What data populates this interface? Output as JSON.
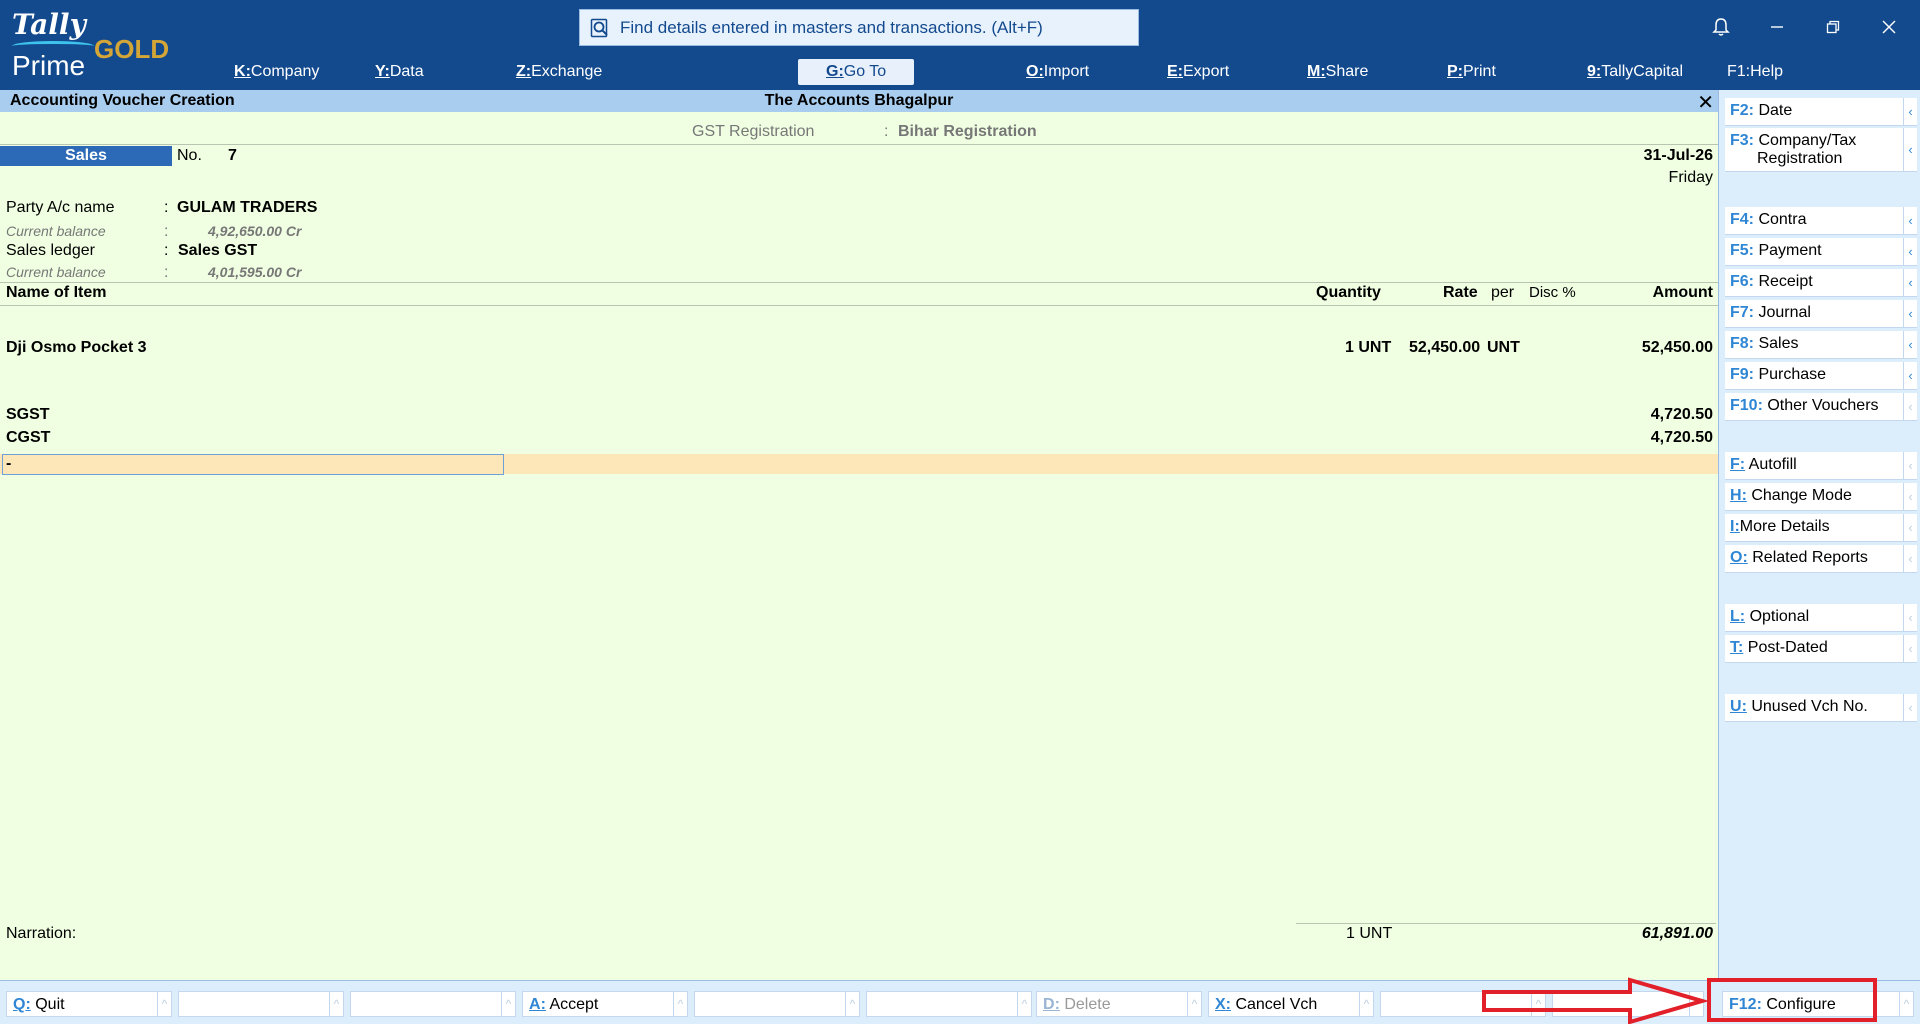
{
  "app": {
    "logo_line1": "Tally",
    "logo_line2": "Prime",
    "logo_edition": "GOLD"
  },
  "search": {
    "text": "Find details entered in masters and transactions. (Alt+F)"
  },
  "menu": [
    {
      "key": "K",
      "label": "Company"
    },
    {
      "key": "Y",
      "label": "Data"
    },
    {
      "key": "Z",
      "label": "Exchange"
    },
    {
      "key": "G",
      "label": "Go To"
    },
    {
      "key": "O",
      "label": "Import"
    },
    {
      "key": "E",
      "label": "Export"
    },
    {
      "key": "M",
      "label": "Share"
    },
    {
      "key": "P",
      "label": "Print"
    },
    {
      "key": "9",
      "label": "TallyCapital"
    },
    {
      "key": "F1",
      "label": "Help"
    }
  ],
  "titlebar": {
    "screen": "Accounting Voucher Creation",
    "company": "The Accounts Bhagalpur",
    "close": "✕"
  },
  "voucher": {
    "gst_label": "GST Registration",
    "gst_sep": ":",
    "gst_value": "Bihar Registration",
    "type": "Sales",
    "no_label": "No.",
    "no_value": "7",
    "date": "31-Jul-26",
    "day": "Friday",
    "party_label": "Party A/c name",
    "party_value": "GULAM TRADERS",
    "party_bal_label": "Current balance",
    "party_bal_value": "4,92,650.00 Cr",
    "sales_label": "Sales ledger",
    "sales_value": "Sales GST",
    "sales_bal_label": "Current balance",
    "sales_bal_value": "4,01,595.00 Cr",
    "sep": ":",
    "columns": {
      "item": "Name of Item",
      "qty": "Quantity",
      "rate": "Rate",
      "per": "per",
      "disc": "Disc %",
      "amount": "Amount"
    },
    "item": {
      "name": "Dji Osmo Pocket 3",
      "qty": "1 UNT",
      "rate": "52,450.00",
      "per": "UNT",
      "amount": "52,450.00"
    },
    "taxes": [
      {
        "name": "SGST",
        "amount": "4,720.50"
      },
      {
        "name": "CGST",
        "amount": "4,720.50"
      }
    ],
    "cursor_text": "-",
    "narration_label": "Narration:",
    "total_qty": "1 UNT",
    "total_amount": "61,891.00"
  },
  "right_panel": [
    {
      "key": "F2",
      "label": "Date",
      "active": true
    },
    {
      "key": "F3",
      "label": "Company/Tax",
      "label2": "Registration",
      "active": true
    },
    {
      "key": "F4",
      "label": "Contra",
      "active": true
    },
    {
      "key": "F5",
      "label": "Payment",
      "active": true
    },
    {
      "key": "F6",
      "label": "Receipt",
      "active": true
    },
    {
      "key": "F7",
      "label": "Journal",
      "active": true
    },
    {
      "key": "F8",
      "label": "Sales",
      "active": true
    },
    {
      "key": "F9",
      "label": "Purchase",
      "active": true
    },
    {
      "key": "F10",
      "label": "Other Vouchers",
      "active": false
    },
    {
      "key": "F",
      "label": "Autofill",
      "active": false
    },
    {
      "key": "H",
      "label": "Change Mode",
      "active": false
    },
    {
      "key": "I",
      "label": "More Details",
      "active": false
    },
    {
      "key": "O",
      "label": "Related Reports",
      "active": false
    },
    {
      "key": "L",
      "label": "Optional",
      "active": false
    },
    {
      "key": "T",
      "label": "Post-Dated",
      "active": false
    },
    {
      "key": "U",
      "label": "Unused Vch No.",
      "active": false
    }
  ],
  "bottom_bar": [
    {
      "key": "Q",
      "label": "Quit"
    },
    {
      "key": "A",
      "label": "Accept"
    },
    {
      "key": "D",
      "label": "Delete"
    },
    {
      "key": "X",
      "label": "Cancel Vch"
    },
    {
      "key": "F12",
      "label": "Configure"
    }
  ],
  "colors": {
    "topbar": "#134a8e",
    "voucher_bg": "#f0ffe2",
    "accent": "#2f86d4",
    "highlight": "#e2202a"
  }
}
